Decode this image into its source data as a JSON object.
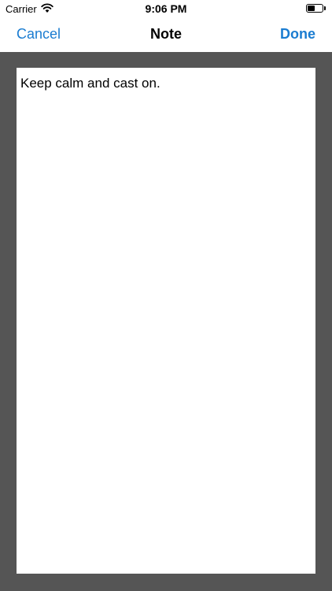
{
  "status_bar": {
    "carrier": "Carrier",
    "time": "9:06 PM",
    "icons": [
      "wifi-icon",
      "battery-icon"
    ],
    "battery_level": 0.5
  },
  "nav": {
    "cancel_label": "Cancel",
    "title": "Note",
    "done_label": "Done",
    "accent_color": "#1a7cd1"
  },
  "note": {
    "text": "Keep calm and cast on.",
    "background": "#555555"
  }
}
